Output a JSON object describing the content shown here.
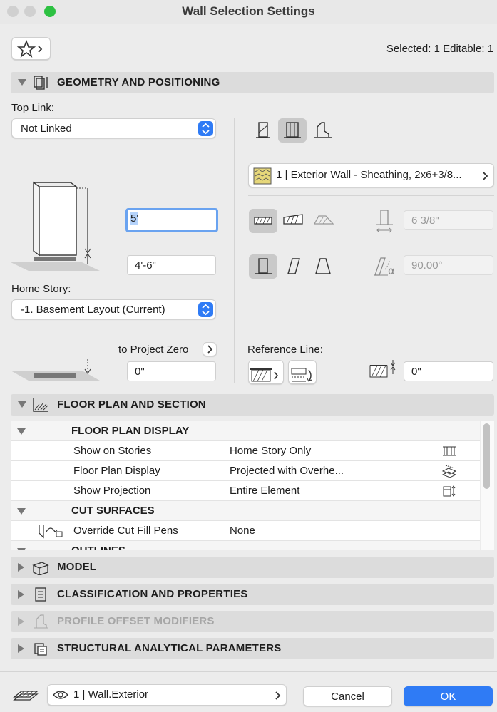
{
  "window": {
    "title": "Wall Selection Settings"
  },
  "header": {
    "selection_info": "Selected: 1 Editable: 1"
  },
  "geometry": {
    "section_label": "GEOMETRY AND POSITIONING",
    "top_link_label": "Top Link:",
    "top_link_value": "Not Linked",
    "height_value": "5'",
    "bottom_offset_value": "4'-6\"",
    "home_story_label": "Home Story:",
    "home_story_value": "-1. Basement Layout (Current)",
    "project_zero_label": "to Project Zero",
    "project_zero_value": "0\"",
    "composite_value": "1 | Exterior Wall - Sheathing, 2x6+3/8...",
    "thickness_value": "6 3/8\"",
    "angle_value": "90.00°",
    "reference_line_label": "Reference Line:",
    "reference_offset_value": "0\""
  },
  "floorplan": {
    "section_label": "FLOOR PLAN AND SECTION",
    "groups": [
      {
        "label": "FLOOR PLAN DISPLAY"
      },
      {
        "label": "CUT SURFACES"
      },
      {
        "label": "OUTLINES"
      }
    ],
    "rows": [
      {
        "name": "Show on Stories",
        "value": "Home Story Only"
      },
      {
        "name": "Floor Plan Display",
        "value": "Projected with Overhe..."
      },
      {
        "name": "Show Projection",
        "value": "Entire Element"
      },
      {
        "name": "Override Cut Fill Pens",
        "value": "None"
      }
    ]
  },
  "sections": {
    "model": "MODEL",
    "classification": "CLASSIFICATION AND PROPERTIES",
    "profile": "PROFILE OFFSET MODIFIERS",
    "structural": "STRUCTURAL ANALYTICAL PARAMETERS"
  },
  "footer": {
    "layer_value": "1 | Wall.Exterior",
    "cancel_label": "Cancel",
    "ok_label": "OK"
  },
  "colors": {
    "accent": "#2f7bf5",
    "close": "#d4d4d4",
    "zoom": "#2dc142"
  }
}
